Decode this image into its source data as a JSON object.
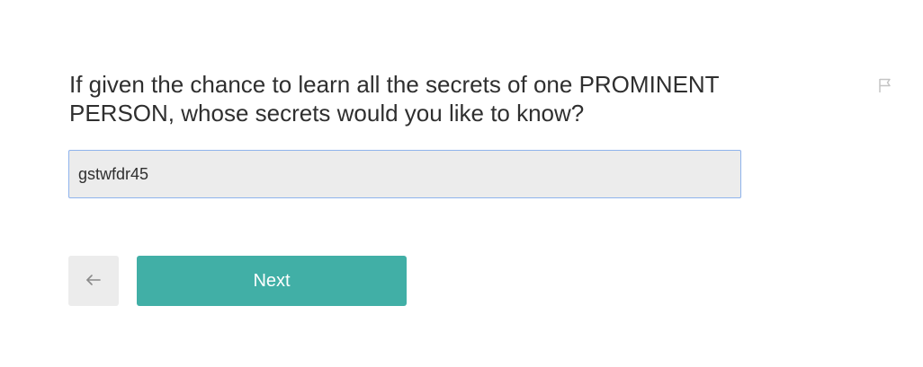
{
  "question": {
    "text": "If given the chance to learn all the secrets of one PROMINENT PERSON, whose secrets would you like to know?"
  },
  "answer": {
    "value": "gstwfdr45",
    "placeholder": ""
  },
  "navigation": {
    "next_label": "Next",
    "back_icon": "arrow-left-icon",
    "flag_icon": "flag-icon"
  },
  "colors": {
    "next_button": "#41afa6",
    "input_border": "#8fb3ec",
    "input_background": "#ececec"
  }
}
